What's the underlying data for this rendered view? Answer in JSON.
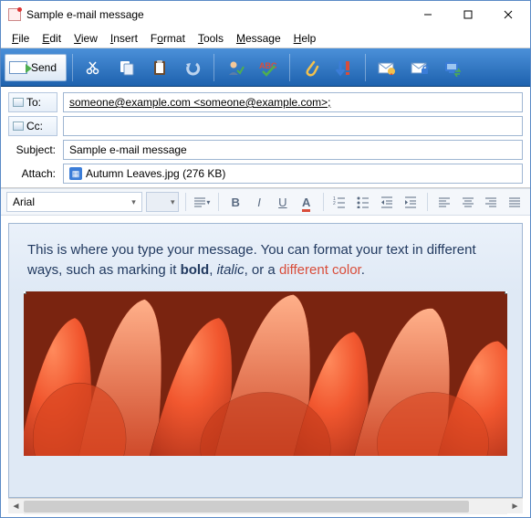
{
  "window": {
    "title": "Sample e-mail message"
  },
  "menu": [
    "File",
    "Edit",
    "View",
    "Insert",
    "Format",
    "Tools",
    "Message",
    "Help"
  ],
  "toolbar": {
    "send": "Send"
  },
  "fields": {
    "to_label": "To:",
    "to_value": "someone@example.com <someone@example.com>;",
    "cc_label": "Cc:",
    "cc_value": "",
    "subject_label": "Subject:",
    "subject_value": "Sample e-mail message",
    "attach_label": "Attach:",
    "attach_value": "Autumn Leaves.jpg (276 KB)"
  },
  "format": {
    "font": "Arial"
  },
  "body": {
    "part1": "This is where you type your message. You can format your text in different ways, such as marking it ",
    "bold": "bold",
    "sep1": ", ",
    "italic": "italic",
    "sep2": ", or a ",
    "color": "different color",
    "end": "."
  },
  "image": {
    "name": "Autumn Leaves",
    "dominant_color": "#e5502f"
  }
}
